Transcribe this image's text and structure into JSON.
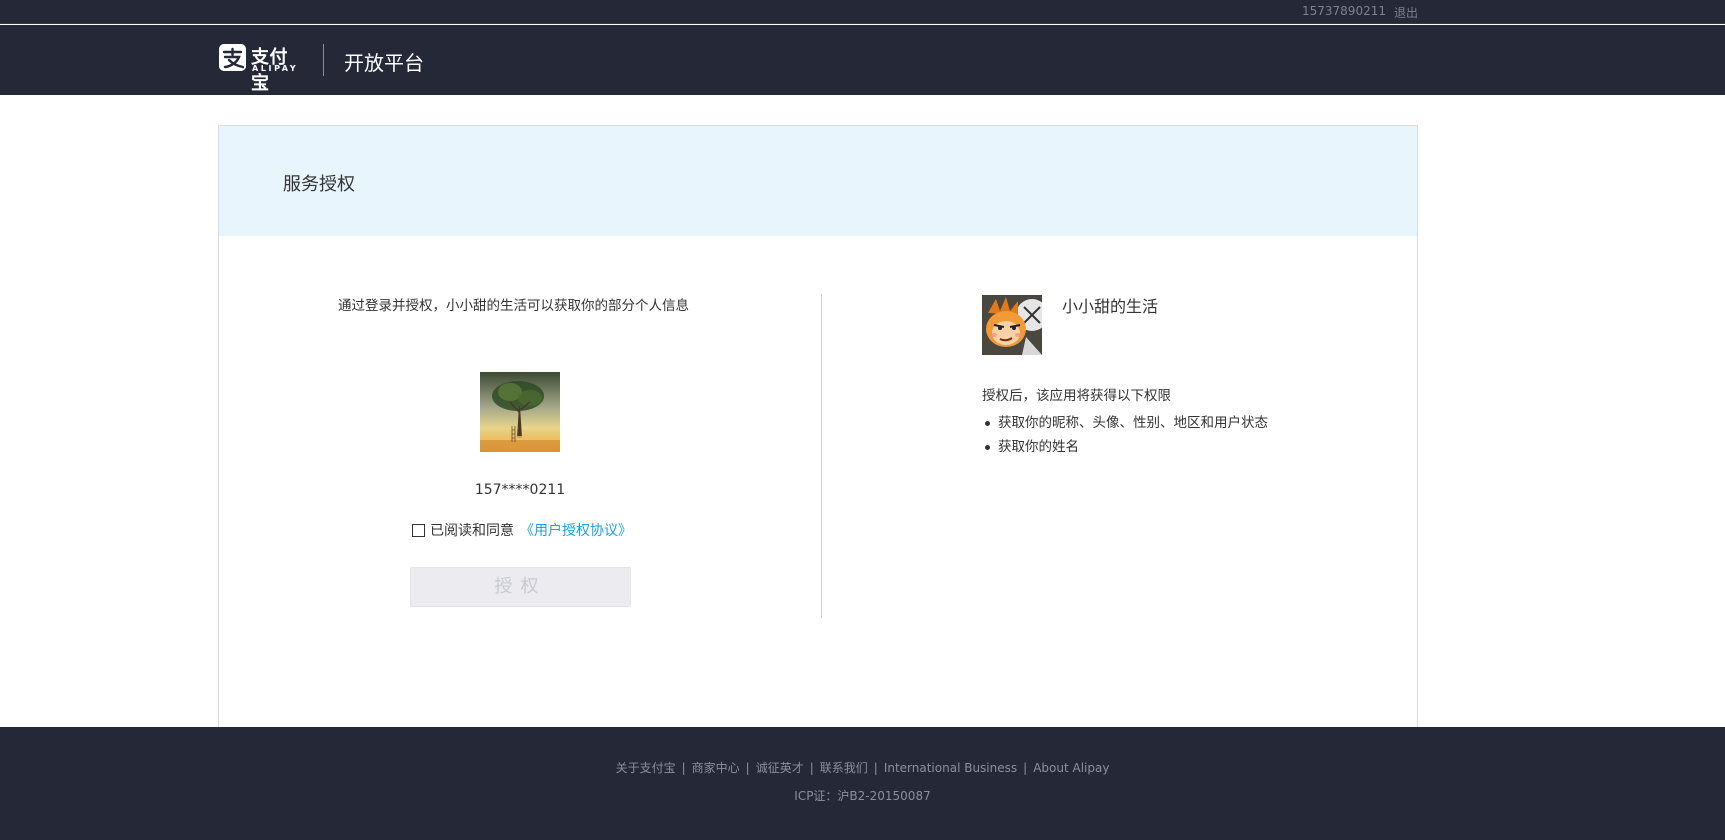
{
  "topbar": {
    "phone": "15737890211",
    "logout_label": "退出"
  },
  "header": {
    "logo_cn": "支付宝",
    "logo_en": "ALIPAY",
    "platform_title": "开放平台"
  },
  "card": {
    "title": "服务授权",
    "intro": "通过登录并授权，小小甜的生活可以获取你的部分个人信息",
    "user_account": "157****0211",
    "agree_text": "已阅读和同意",
    "agree_link": "《用户授权协议》",
    "agree_checked": false,
    "auth_button": "授权"
  },
  "app": {
    "name": "小小甜的生活",
    "perm_title": "授权后，该应用将获得以下权限",
    "permissions": [
      "获取你的昵称、头像、性别、地区和用户状态",
      "获取你的姓名"
    ]
  },
  "footer": {
    "links": [
      "关于支付宝",
      "商家中心",
      "诚征英才",
      "联系我们",
      "International Business",
      "About Alipay"
    ],
    "icp": "ICP证：沪B2-20150087"
  },
  "colors": {
    "dark_bg": "#242837",
    "head_bg": "#e8f5fd",
    "link": "#1aa3e2",
    "disabled_btn": "#ebebf0"
  }
}
